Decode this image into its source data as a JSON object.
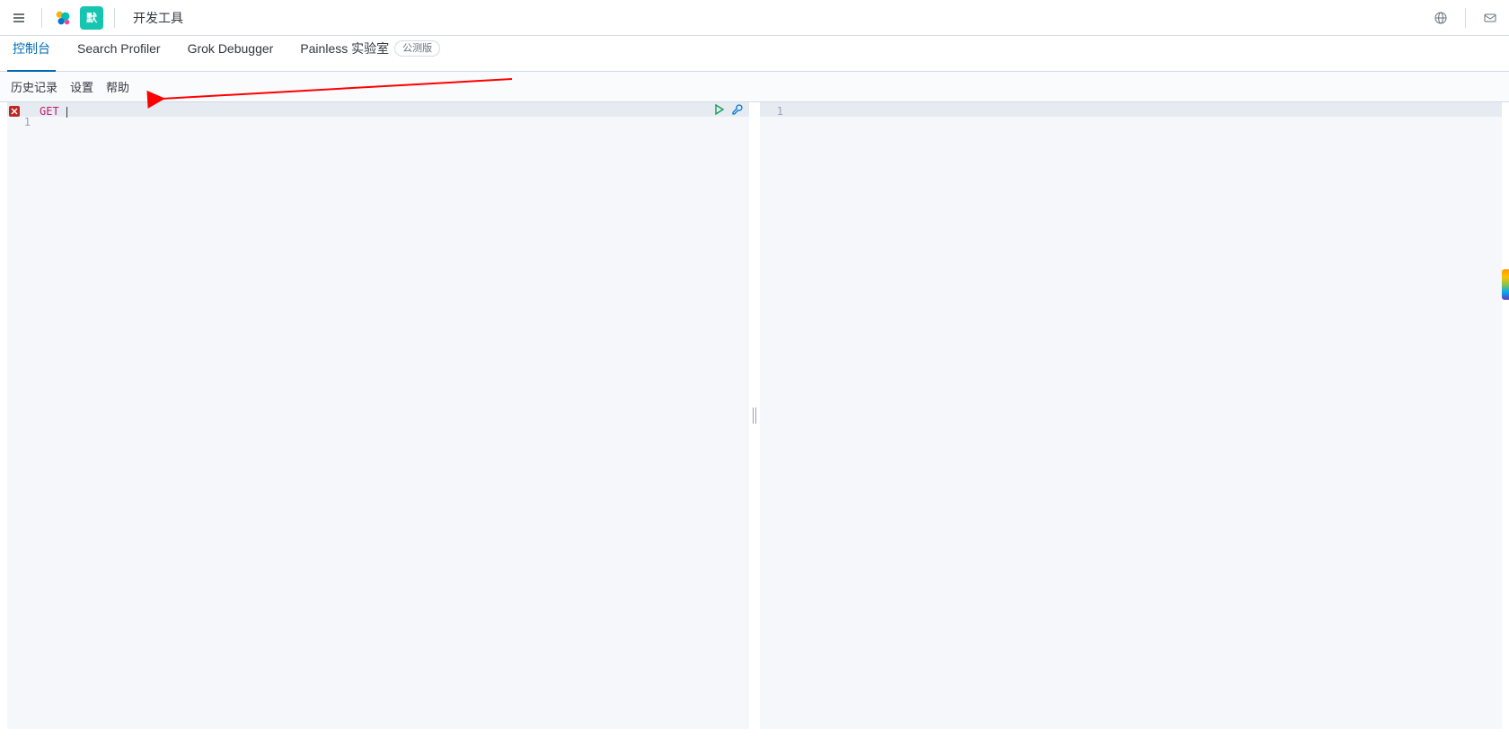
{
  "header": {
    "breadcrumb_title": "开发工具",
    "space_badge_text": "默"
  },
  "tabs": {
    "console": "控制台",
    "search_profiler": "Search Profiler",
    "grok_debugger": "Grok Debugger",
    "painless_lab": "Painless 实验室",
    "beta_label": "公测版"
  },
  "submenu": {
    "history": "历史记录",
    "settings": "设置",
    "help": "帮助"
  },
  "editor": {
    "request_line_number": "1",
    "request_keyword": "GET",
    "response_line_number": "1"
  }
}
